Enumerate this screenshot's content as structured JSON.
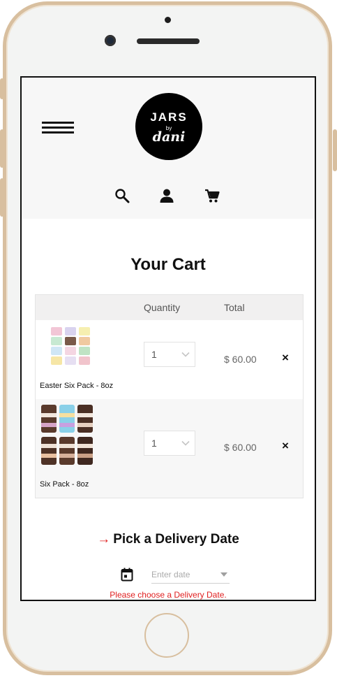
{
  "header": {
    "logo": {
      "line1": "JARS",
      "line2": "by",
      "line3": "dani"
    },
    "icons": [
      "menu-icon",
      "search-icon",
      "user-icon",
      "cart-icon"
    ]
  },
  "page_title": "Your Cart",
  "cart": {
    "columns": [
      "",
      "Quantity",
      "Total",
      ""
    ],
    "items": [
      {
        "name": "Easter Six Pack - 8oz",
        "quantity": "1",
        "total": "$ 60.00",
        "remove": "×"
      },
      {
        "name": "Six Pack - 8oz",
        "quantity": "1",
        "total": "$ 60.00",
        "remove": "×"
      }
    ]
  },
  "delivery": {
    "arrow": "→",
    "title": "Pick a Delivery Date",
    "date_placeholder": "Enter date",
    "error": "Please choose a Delivery Date."
  },
  "colors": {
    "accent": "#e02020",
    "frame": "#d8bf9f",
    "header_bg": "#f7f7f7"
  }
}
